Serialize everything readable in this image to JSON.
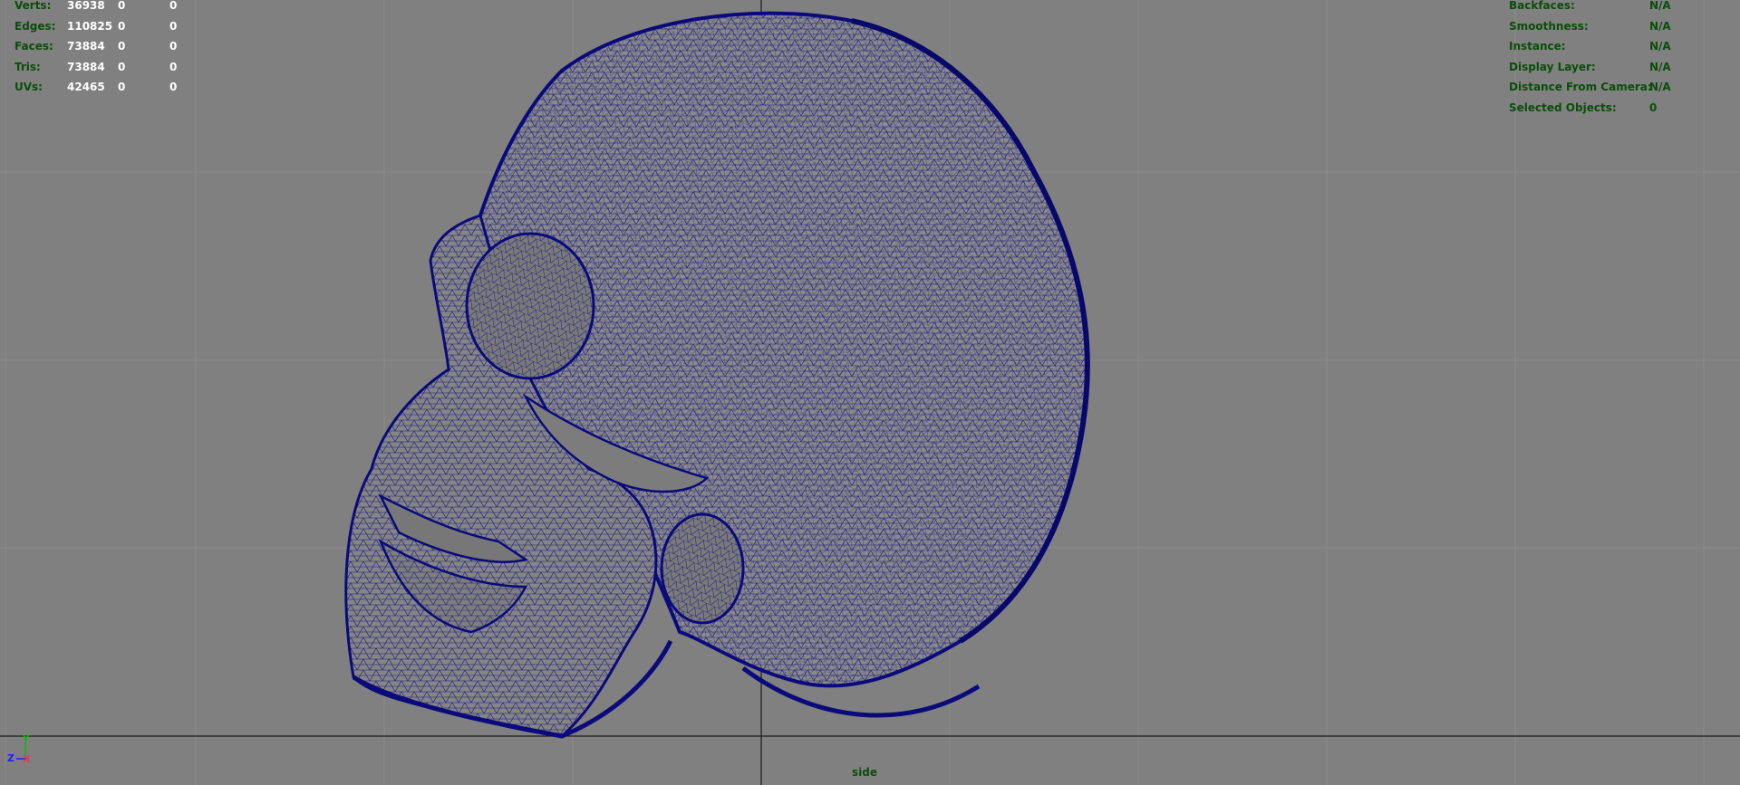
{
  "stats": {
    "rows": [
      {
        "label": "Verts:",
        "v1": "36938",
        "v2": "0",
        "v3": "0"
      },
      {
        "label": "Edges:",
        "v1": "110825",
        "v2": "0",
        "v3": "0"
      },
      {
        "label": "Faces:",
        "v1": "73884",
        "v2": "0",
        "v3": "0"
      },
      {
        "label": "Tris:",
        "v1": "73884",
        "v2": "0",
        "v3": "0"
      },
      {
        "label": "UVs:",
        "v1": "42465",
        "v2": "0",
        "v3": "0"
      }
    ]
  },
  "info": {
    "rows": [
      {
        "label": "Backfaces:",
        "value": "N/A"
      },
      {
        "label": "Smoothness:",
        "value": "N/A"
      },
      {
        "label": "Instance:",
        "value": "N/A"
      },
      {
        "label": "Display Layer:",
        "value": "N/A"
      },
      {
        "label": "Distance From Camera:",
        "value": "N/A"
      },
      {
        "label": "Selected Objects:",
        "value": "0"
      }
    ]
  },
  "camera": {
    "name": "side"
  },
  "gizmo": {
    "y_label": "Y",
    "z_label": "Z",
    "x_label": "X"
  },
  "colors": {
    "background": "#808080",
    "grid": "#8c8c8c",
    "axis": "#1a1a1a",
    "wireframe": "#0a0a7a",
    "hud_label": "#0b4d0b",
    "hud_value": "#ffffff"
  },
  "icons": {
    "gizmo": "axis-gizmo-icon",
    "mesh": "skull-wireframe-mesh"
  }
}
